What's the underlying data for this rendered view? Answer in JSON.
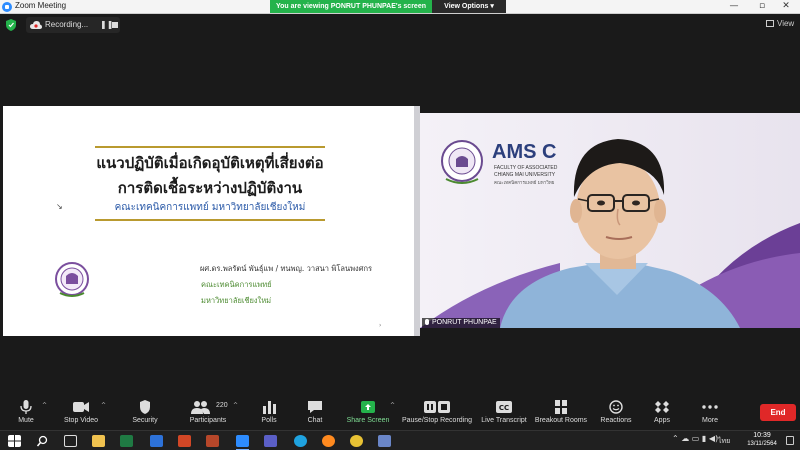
{
  "window": {
    "title": "Zoom Meeting"
  },
  "share_banner": {
    "text": "You are viewing PONRUT PHUNPAE's screen",
    "view_options": "View Options"
  },
  "recording": {
    "label": "Recording..."
  },
  "view_button": {
    "label": "View"
  },
  "slide": {
    "title_line1": "แนวปฏิบัติเมื่อเกิดอุบัติเหตุที่เสี่ยงต่อ",
    "title_line2": "การติดเชื้อระหว่างปฏิบัติงาน",
    "subtitle": "คณะเทคนิคการแพทย์ มหาวิทยาลัยเชียงใหม่",
    "author": "ผศ.ดร.พลรัตน์ พันธุ์แพ / ทนพญ. วาสนา พิโลนพงศกร",
    "department": "คณะเทคนิคการแพทย์",
    "university": "มหาวิทยาลัยเชียงใหม่"
  },
  "video": {
    "participant_name": "PONRUT PHUNPAE",
    "bg_logo_text": "AMS C",
    "bg_sub1": "FACULTY OF ASSOCIATED",
    "bg_sub2": "CHIANG MAI UNIVERSITY",
    "bg_sub3": "คณะเทคนิคการแพทย์ มหาวิทย"
  },
  "toolbar": {
    "mute": "Mute",
    "stop_video": "Stop Video",
    "security": "Security",
    "participants": "Participants",
    "participants_count": "220",
    "polls": "Polls",
    "chat": "Chat",
    "share_screen": "Share Screen",
    "pause_recording": "Pause/Stop Recording",
    "live_transcript": "Live Transcript",
    "breakout_rooms": "Breakout Rooms",
    "reactions": "Reactions",
    "apps": "Apps",
    "more": "More",
    "end": "End",
    "accent_share": "#24b34b",
    "end_color": "#e02828"
  },
  "taskbar": {
    "time": "10:39",
    "date": "13/11/2564",
    "language": "ไทย"
  }
}
